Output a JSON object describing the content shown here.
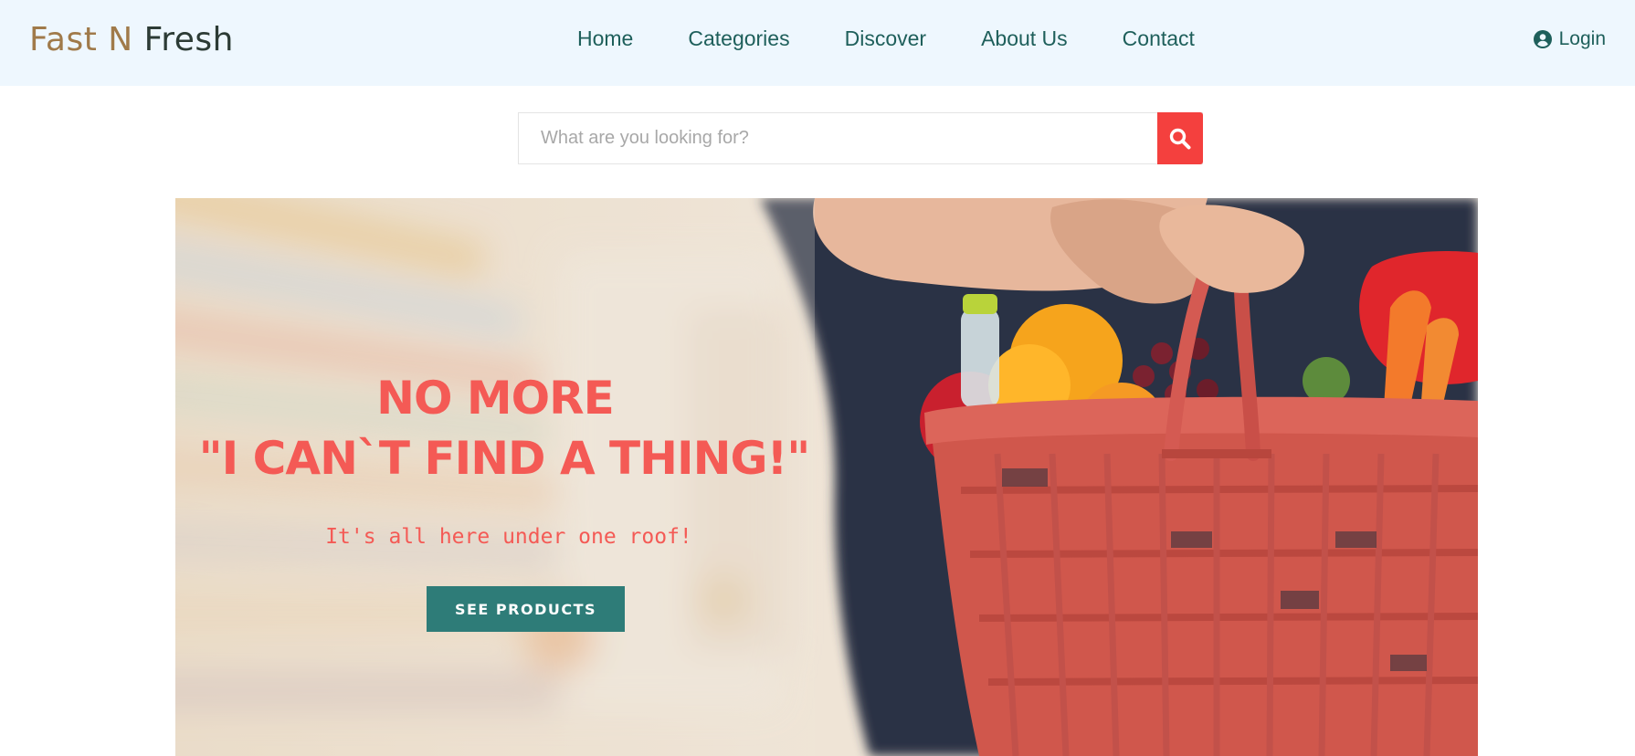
{
  "header": {
    "logo_part1": "Fast N ",
    "logo_part2": "Fresh",
    "nav": [
      {
        "label": "Home"
      },
      {
        "label": "Categories"
      },
      {
        "label": "Discover"
      },
      {
        "label": "About Us"
      },
      {
        "label": "Contact"
      }
    ],
    "login_label": "Login",
    "login_icon": "user-circle-icon"
  },
  "search": {
    "placeholder": "What are you looking for?",
    "value": "",
    "icon": "search-icon"
  },
  "hero": {
    "title_line1": "NO MORE",
    "title_line2": "\"I CAN`T FIND A THING!\"",
    "subtitle": "It's all here under one roof!",
    "button_label": "SEE PRODUCTS"
  },
  "colors": {
    "header_bg": "#eef7fe",
    "nav_text": "#1e5f5b",
    "accent_red": "#f45a55",
    "search_button": "#f4403e",
    "cta_button": "#2e7c78"
  }
}
